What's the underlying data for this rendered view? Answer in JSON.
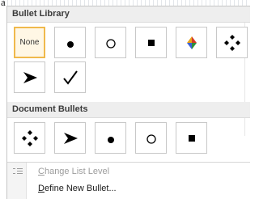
{
  "corner_text": "a",
  "sections": {
    "bullet_library": {
      "title": "Bullet Library",
      "tiles": [
        {
          "label": "None",
          "icon": "none",
          "selected": true
        },
        {
          "icon": "filled-circle-bullet"
        },
        {
          "icon": "hollow-circle-bullet"
        },
        {
          "icon": "filled-square-bullet"
        },
        {
          "icon": "four-color-diamond-bullet"
        },
        {
          "icon": "four-diamond-cluster-bullet"
        },
        {
          "icon": "arrowhead-bullet"
        },
        {
          "icon": "checkmark-bullet"
        }
      ]
    },
    "document_bullets": {
      "title": "Document Bullets",
      "tiles": [
        {
          "icon": "four-diamond-cluster-bullet"
        },
        {
          "icon": "arrowhead-bullet"
        },
        {
          "icon": "filled-circle-bullet"
        },
        {
          "icon": "hollow-circle-bullet"
        },
        {
          "icon": "filled-square-bullet"
        }
      ]
    }
  },
  "menu_items": {
    "change_list_level": {
      "prefix": "C",
      "label": "hange List Level",
      "enabled": false,
      "icon": "list-level-icon"
    },
    "define_new_bullet": {
      "prefix": "D",
      "label": "efine New Bullet...",
      "enabled": true
    }
  },
  "colors": {
    "selection_border": "#f0b94c",
    "selection_fill": "#fff7e5",
    "header_bg": "#eeeeee",
    "bullet_color": "#000000"
  }
}
